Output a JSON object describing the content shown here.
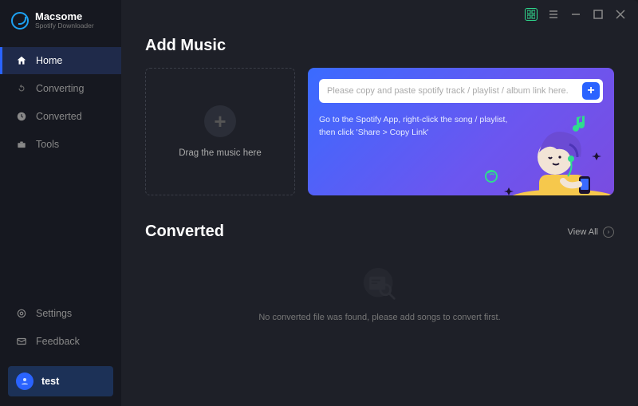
{
  "brand": {
    "title": "Macsome",
    "subtitle": "Spotify Downloader"
  },
  "nav": {
    "home": "Home",
    "converting": "Converting",
    "converted": "Converted",
    "tools": "Tools",
    "settings": "Settings",
    "feedback": "Feedback"
  },
  "account": {
    "name": "test"
  },
  "sections": {
    "add_music_title": "Add Music",
    "dropzone_text": "Drag the music here",
    "link_placeholder": "Please copy and paste spotify track / playlist / album link here.",
    "link_hint": "Go to the Spotify App, right-click the song / playlist, then click 'Share > Copy Link'",
    "converted_title": "Converted",
    "view_all": "View All",
    "empty_text": "No converted file was found, please add songs to convert first."
  }
}
